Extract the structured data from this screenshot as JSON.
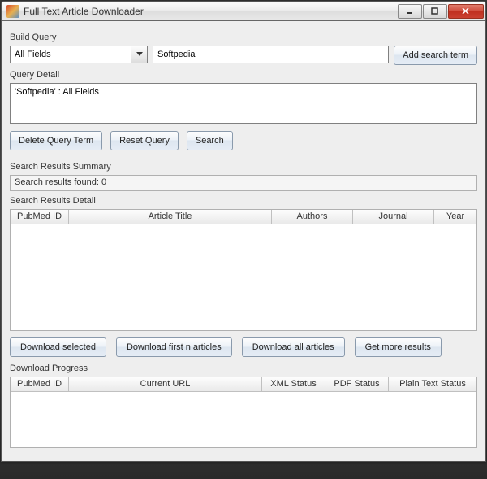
{
  "window": {
    "title": "Full Text Article Downloader"
  },
  "build_query": {
    "label": "Build Query",
    "field_select": "All Fields",
    "search_value": "Softpedia",
    "add_term_label": "Add search term"
  },
  "query_detail": {
    "label": "Query Detail",
    "text": "'Softpedia' : All Fields",
    "delete_label": "Delete Query Term",
    "reset_label": "Reset Query",
    "search_label": "Search"
  },
  "results_summary": {
    "label": "Search Results Summary",
    "text": "Search results found: 0"
  },
  "results_detail": {
    "label": "Search Results Detail",
    "columns": {
      "pubmed_id": "PubMed ID",
      "article_title": "Article Title",
      "authors": "Authors",
      "journal": "Journal",
      "year": "Year"
    }
  },
  "actions": {
    "download_selected": "Download selected",
    "download_first_n": "Download first n articles",
    "download_all": "Download all articles",
    "get_more": "Get more results"
  },
  "download_progress": {
    "label": "Download Progress",
    "columns": {
      "pubmed_id": "PubMed ID",
      "current_url": "Current URL",
      "xml_status": "XML Status",
      "pdf_status": "PDF Status",
      "plain_text_status": "Plain Text Status"
    }
  }
}
